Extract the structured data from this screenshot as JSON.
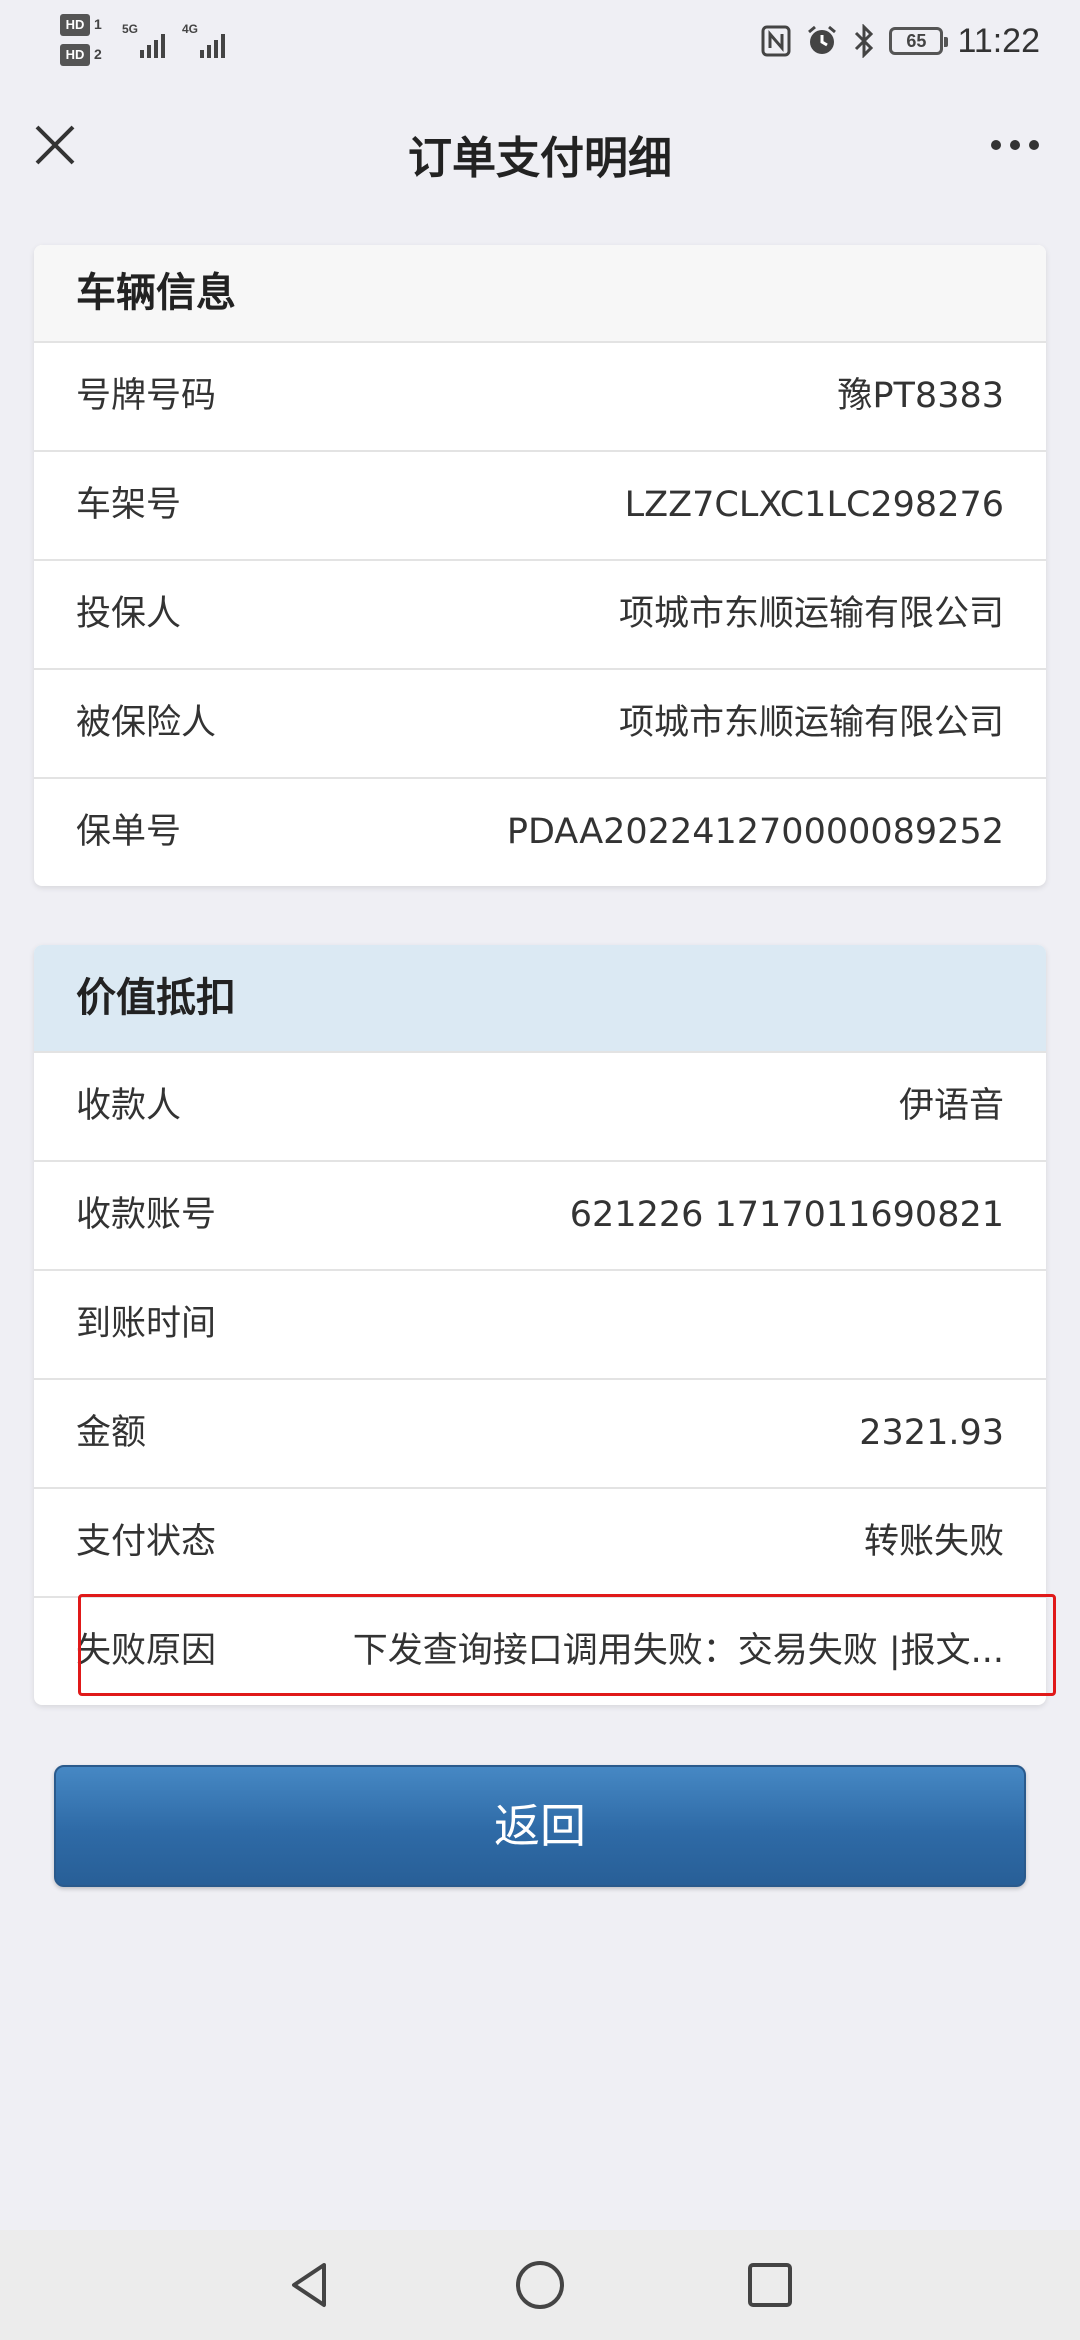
{
  "status_bar": {
    "sim1": "HD",
    "sim1_num": "1",
    "sim2": "HD",
    "sim2_num": "2",
    "net1": "5G",
    "net2": "4G",
    "battery": "65",
    "time": "11:22",
    "icons": [
      "nfc-icon",
      "alarm-icon",
      "bluetooth-icon"
    ]
  },
  "header": {
    "title": "订单支付明细",
    "close_icon": "close-icon",
    "more_icon": "more-icon"
  },
  "vehicle_info": {
    "title": "车辆信息",
    "rows": [
      {
        "label": "号牌号码",
        "value": "豫PT8383"
      },
      {
        "label": "车架号",
        "value": "LZZ7CLXC1LC298276"
      },
      {
        "label": "投保人",
        "value": "项城市东顺运输有限公司"
      },
      {
        "label": "被保险人",
        "value": "项城市东顺运输有限公司"
      },
      {
        "label": "保单号",
        "value": "PDAA202241270000089252"
      }
    ]
  },
  "value_deduction": {
    "title": "价值抵扣",
    "rows": [
      {
        "label": "收款人",
        "value": "伊语音"
      },
      {
        "label": "收款账号",
        "value": "621226 1717011690821"
      },
      {
        "label": "到账时间",
        "value": ""
      },
      {
        "label": "金额",
        "value": "2321.93"
      },
      {
        "label": "支付状态",
        "value": "转账失败"
      },
      {
        "label": "失败原因",
        "value": "下发查询接口调用失败：交易失败 |报文..."
      }
    ]
  },
  "actions": {
    "back_label": "返回"
  },
  "nav_bar": {
    "icons": [
      "back-nav-icon",
      "home-nav-icon",
      "recents-nav-icon"
    ]
  },
  "colors": {
    "background": "#efeff4",
    "button": "#2e6aa6",
    "deduct_header": "#dbe9f3",
    "highlight": "#e01919"
  }
}
